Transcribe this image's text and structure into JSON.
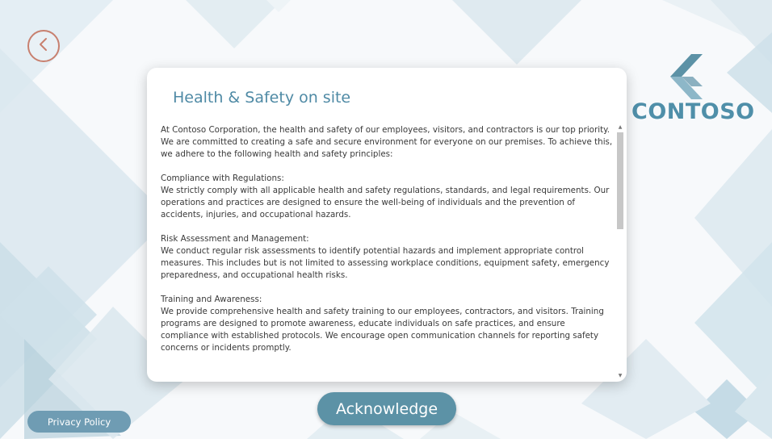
{
  "header": {
    "back_icon": "chevron-left-icon"
  },
  "logo": {
    "text": "CONTOSO",
    "icon": "contoso-logo-icon",
    "color": "#4f8fa9"
  },
  "dialog": {
    "title": "Health & Safety on site",
    "paragraphs": [
      "At Contoso Corporation, the health and safety of our employees, visitors, and contractors is our top priority. We are committed to creating a safe and secure environment for everyone on our premises. To achieve this, we adhere to the following health and safety principles:",
      "Compliance with Regulations:\nWe strictly comply with all applicable health and safety regulations, standards, and legal requirements. Our operations and practices are designed to ensure the well-being of individuals and the prevention of accidents, injuries, and occupational hazards.",
      "Risk Assessment and Management:\nWe conduct regular risk assessments to identify potential hazards and implement appropriate control measures. This includes but is not limited to assessing workplace conditions, equipment safety, emergency preparedness, and occupational health risks.",
      "Training and Awareness:\nWe provide comprehensive health and safety training to our employees, contractors, and visitors. Training programs are designed to promote awareness, educate individuals on safe practices, and ensure compliance with established protocols. We encourage open communication channels for reporting safety concerns or incidents promptly."
    ]
  },
  "buttons": {
    "acknowledge": "Acknowledge",
    "privacy_policy": "Privacy Policy"
  },
  "colors": {
    "accent": "#5c92a6",
    "title": "#4f8aa5",
    "back_ring": "#c8806f",
    "privacy": "#6f9cb3"
  }
}
